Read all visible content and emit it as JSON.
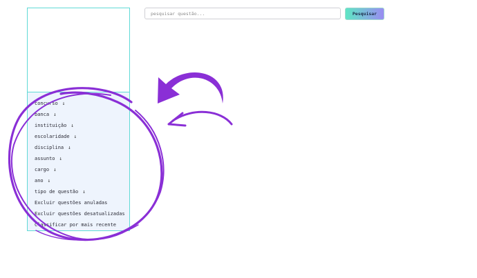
{
  "search": {
    "placeholder": "pesquisar questão...",
    "button_label": "Pesquisar"
  },
  "filters": {
    "items": [
      {
        "label": "concurso",
        "arrow": "↓"
      },
      {
        "label": "banca",
        "arrow": "↓"
      },
      {
        "label": "instituição",
        "arrow": "↓"
      },
      {
        "label": "escolaridade",
        "arrow": "↓"
      },
      {
        "label": "disciplina",
        "arrow": "↓"
      },
      {
        "label": "assunto",
        "arrow": "↓"
      },
      {
        "label": "cargo",
        "arrow": "↓"
      },
      {
        "label": "ano",
        "arrow": "↓"
      },
      {
        "label": "tipo de questão",
        "arrow": "↓"
      }
    ],
    "options": [
      {
        "label": "Excluir questões anuladas"
      },
      {
        "label": "Excluir questões desatualizadas"
      },
      {
        "label": "Classificar por mais recente"
      }
    ]
  },
  "annotation": {
    "color": "#8a2fd6",
    "icons": [
      "circle-highlight",
      "curved-arrow-icon"
    ]
  }
}
